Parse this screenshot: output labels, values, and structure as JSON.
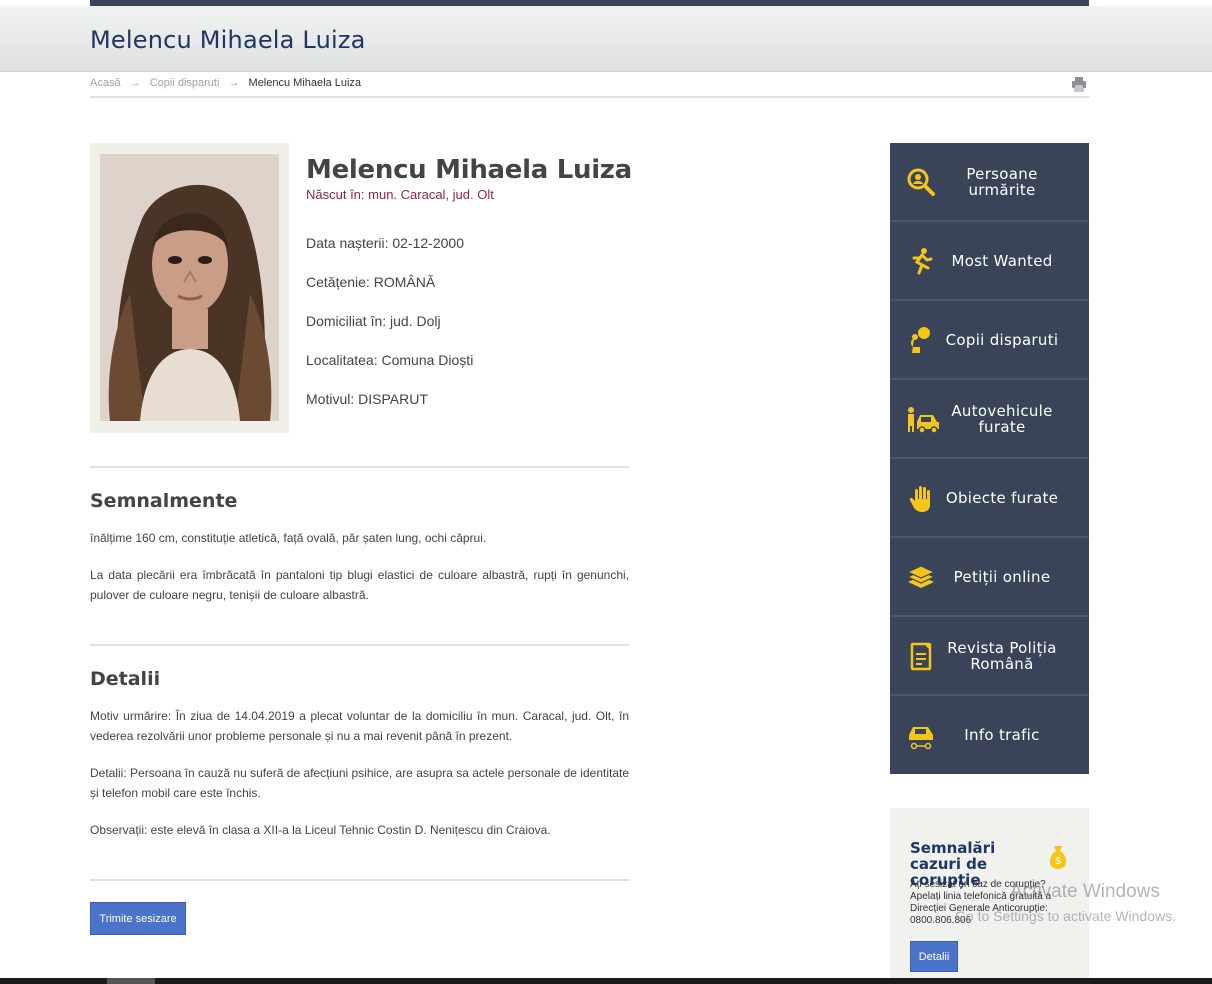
{
  "header": {
    "title": "Melencu Mihaela Luiza"
  },
  "breadcrumb": {
    "items": [
      "Acasă",
      "Copii disparuti"
    ],
    "current": "Melencu Mihaela Luiza",
    "separator": "→"
  },
  "icons": {
    "print": "print-icon",
    "photo": "person-photo"
  },
  "profile": {
    "name": "Melencu Mihaela Luiza",
    "birthplace": "Născut în: mun. Caracal, jud. Olt",
    "birth_date": "Data nașterii: 02-12-2000",
    "citizenship": "Cetățenie: ROMÂNĂ",
    "residence": "Domiciliat în: jud. Dolj",
    "locality": "Localitatea: Comuna Dioști",
    "reason": "Motivul: DISPARUT"
  },
  "semnalmente": {
    "title": "Semnalmente",
    "p1": "înălțime 160 cm, constituție atletică, față ovală, păr șaten lung, ochi căprui.",
    "p2": "La data plecării era îmbrăcată în pantaloni tip blugi elastici de culoare albastră, rupți în genunchi, pulover de culoare negru, tenișii de culoare albastră."
  },
  "detalii": {
    "title": "Detalii",
    "p1": "Motiv urmărire: În ziua de 14.04.2019 a plecat voluntar de la domiciliu în mun. Caracal, jud. Olt, în vederea rezolvării unor probleme personale și nu a mai revenit până în prezent.",
    "p2": "Detalii: Persoana în cauză nu suferă de afecțiuni psihice, are asupra sa actele personale de identitate și telefon mobil care este închis.",
    "p3": "Observații: este elevă în clasa a XII-a la Liceul Tehnic Costin D. Nenițescu din Craiova."
  },
  "actions": {
    "submit_label": "Trimite sesizare"
  },
  "sidebar": {
    "items": [
      {
        "label": "Persoane urmărite",
        "icon": "search-person-icon"
      },
      {
        "label": "Most Wanted",
        "icon": "running-person-icon"
      },
      {
        "label": "Copii disparuti",
        "icon": "child-icon"
      },
      {
        "label": "Autovehicule furate",
        "icon": "car-thief-icon"
      },
      {
        "label": "Obiecte furate",
        "icon": "hand-icon"
      },
      {
        "label": "Petiții online",
        "icon": "papers-icon"
      },
      {
        "label": "Revista Poliția Română",
        "icon": "magazine-icon"
      },
      {
        "label": "Info trafic",
        "icon": "traffic-car-icon"
      }
    ]
  },
  "corruption": {
    "title": "Semnalări cazuri de corupție",
    "text": "Ați sesizat un caz de corupție? Apelați linia telefonică gratuită a Direcției Generale Anticorupție: 0800.806.806",
    "button_label": "Detalii",
    "icon": "money-bag-icon"
  },
  "watermark": {
    "line1": "Activate Windows",
    "line2": "Go to Settings to activate Windows."
  },
  "colors": {
    "accent": "#f5c518",
    "sidebar_bg": "#3a4459",
    "title": "#1f3566",
    "birthplace": "#8a2a43",
    "button": "#4a73c9"
  }
}
